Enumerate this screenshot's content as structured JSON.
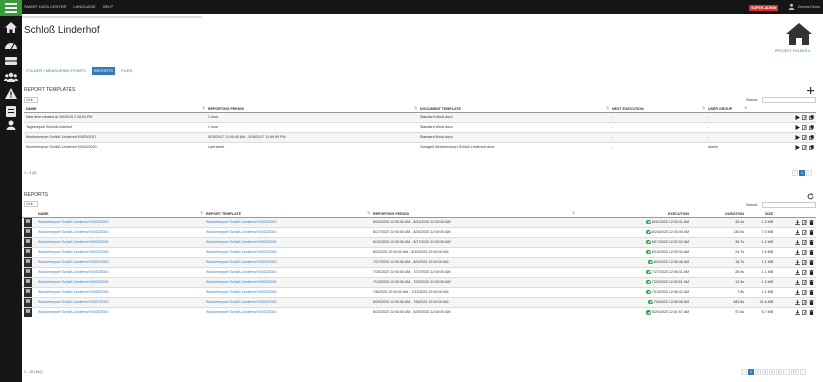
{
  "topbar": {
    "menu": [
      "SMART DATA CENTER",
      "LANGUAGE",
      "HELP"
    ],
    "badge": "SUPER-ADMIN",
    "user": "Demos Demo"
  },
  "sidebar": {
    "icons": [
      "home-icon",
      "dashboard-icon",
      "storage-icon",
      "users-icon",
      "warning-icon",
      "device-icon",
      "user-icon"
    ]
  },
  "page": {
    "title": "Schloß Linderhof",
    "project_folder": "PROJECT FOLDER ▾"
  },
  "tabs": [
    {
      "label": "FOLDER / MEASURING POINTS",
      "active": false
    },
    {
      "label": "REPORTS",
      "active": true
    },
    {
      "label": "FILES",
      "active": false
    }
  ],
  "templates": {
    "heading": "REPORT TEMPLATES",
    "page_size": "10",
    "search_label": "Search:",
    "columns": [
      "NAME",
      "REPORTING PERIOD",
      "DOCUMENT TEMPLATE",
      "NEXT EXECUTION",
      "USER GROUP"
    ],
    "rows": [
      {
        "name": "New item created at 3/9/2018 2:28:54 PM",
        "period": "1 hour",
        "doc": "Standard Word.docx",
        "next": "-",
        "group": "-"
      },
      {
        "name": "Tagesreport SchloßLinderhof",
        "period": "1 hour",
        "doc": "Standard Word.docx",
        "next": "-",
        "group": "-"
      },
      {
        "name": "Wochenreport Schloß Linderhof KW20/2017",
        "period": "5/15/2017 12:00:00 AM - 5/18/2017 11:59:59 PM",
        "doc": "Standard Word.docx",
        "next": "-",
        "group": "-"
      },
      {
        "name": "Wochenreport Schloß Linderhof KW32/2020",
        "period": "Last week",
        "doc": "Vorlage5 Wochenreport Schloß Linderhof.docx",
        "next": "-",
        "group": "Admin"
      }
    ],
    "info": "1 - 4 (4)",
    "pages": [
      "‹",
      "1",
      "›"
    ],
    "active_page": "1"
  },
  "reports": {
    "heading": "REPORTS",
    "page_size": "10",
    "search_label": "Search:",
    "columns": [
      "NAME",
      "REPORT TEMPLATE",
      "REPORTING PERIOD",
      "EXECUTION",
      "DURATION",
      "SIZE"
    ],
    "rows": [
      {
        "name": "Wochenreport Schloß Linderhof KW32/2020",
        "template": "Wochenreport Schloß Linderhof KW32/2020",
        "period": "8/24/2020 12:00:00 AM - 8/31/2020 12:00:00 AM",
        "exec": "8/31/2020 12:02:41 AM",
        "duration": "45.4s",
        "size": "1.3 MB"
      },
      {
        "name": "Wochenreport Schloß Linderhof KW32/2020",
        "template": "Wochenreport Schloß Linderhof KW32/2020",
        "period": "8/17/2020 12:00:00 AM - 8/24/2020 12:00:00 AM",
        "exec": "8/24/2020 12:03:30 AM",
        "duration": "130.0s",
        "size": "7.0 MB"
      },
      {
        "name": "Wochenreport Schloß Linderhof KW32/2020",
        "template": "Wochenreport Schloß Linderhof KW32/2020",
        "period": "8/10/2020 12:00:00 AM - 8/17/2020 12:00:00 AM",
        "exec": "8/17/2020 12:02:32 AM",
        "duration": "36.7s",
        "size": "1.2 MB"
      },
      {
        "name": "Wochenreport Schloß Linderhof KW32/2020",
        "template": "Wochenreport Schloß Linderhof KW32/2020",
        "period": "8/3/2020 12:00:00 AM - 8/10/2020 12:00:00 AM",
        "exec": "8/10/2020 12:09:30 AM",
        "duration": "24.7s",
        "size": "1.6 MB"
      },
      {
        "name": "Wochenreport Schloß Linderhof KW31/2020",
        "template": "Wochenreport Schloß Linderhof KW32/2020",
        "period": "7/27/2020 12:00:00 AM - 8/3/2020 12:00:00 AM",
        "exec": "8/3/2020 12:06:46 AM",
        "duration": "18.7s",
        "size": "1.1 MB"
      },
      {
        "name": "Wochenreport Schloß Linderhof KW30/2020",
        "template": "Wochenreport Schloß Linderhof KW32/2020",
        "period": "7/20/2020 12:00:00 AM - 7/27/2020 12:00:00 AM",
        "exec": "7/27/2020 12:06:31 AM",
        "duration": "28.9s",
        "size": "1.1 MB"
      },
      {
        "name": "Wochenreport Schloß Linderhof KW29/2020",
        "template": "Wochenreport Schloß Linderhof KW32/2020",
        "period": "7/13/2020 12:00:00 AM - 7/20/2020 12:00:00 AM",
        "exec": "7/20/2020 12:05:51 AM",
        "duration": "12.9s",
        "size": "1.3 MB"
      },
      {
        "name": "Wochenreport Schloß Linderhof KW28/2020",
        "template": "Wochenreport Schloß Linderhof KW32/2020",
        "period": "7/6/2020 12:00:00 AM - 7/13/2020 12:00:00 AM",
        "exec": "7/13/2020 12:06:42 AM",
        "duration": "7.8s",
        "size": "1.1 MB"
      },
      {
        "name": "Wochenreport Schloß Linderhof KW27/2020",
        "template": "Wochenreport Schloß Linderhof KW32/2020",
        "period": "6/29/2020 12:00:00 AM - 7/6/2020 12:00:00 AM",
        "exec": "7/6/2020 12:08:38 AM",
        "duration": "483.8s",
        "size": "31.6 MB"
      },
      {
        "name": "Wochenreport Schloß Linderhof KW26/2020",
        "template": "Wochenreport Schloß Linderhof KW32/2020",
        "period": "6/22/2020 12:00:00 AM - 6/29/2020 12:00:00 AM",
        "exec": "6/29/2020 12:01:57 AM",
        "duration": "97.6s",
        "size": "6.7 MB"
      }
    ],
    "info": "1 - 10 (162)",
    "pages": [
      "‹",
      "1",
      "2",
      "3",
      "4",
      "5",
      "...",
      "17",
      "›"
    ],
    "active_page": "1"
  },
  "colors": {
    "topbar": "#151515",
    "accent": "#337ab7",
    "logo": "#3a9b3a",
    "badge": "#d9302c",
    "success": "#1e9b43"
  }
}
